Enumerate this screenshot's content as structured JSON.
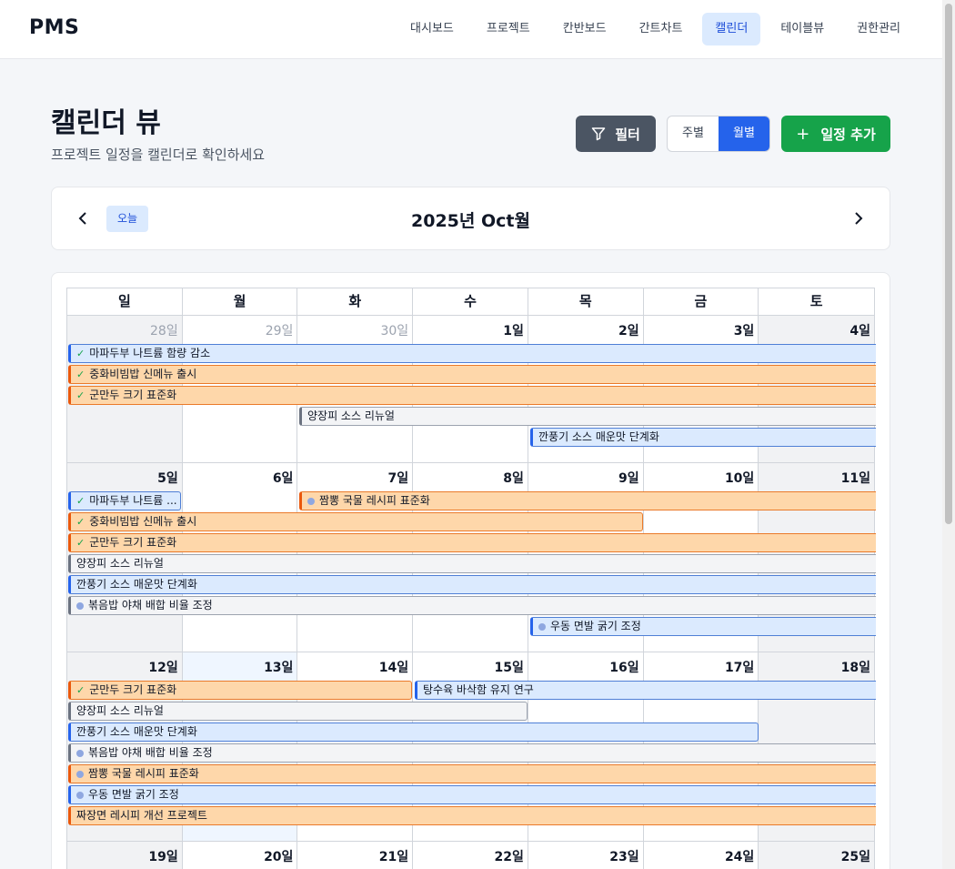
{
  "app": {
    "logo": "PMS"
  },
  "nav": [
    {
      "label": "대시보드",
      "active": false
    },
    {
      "label": "프로젝트",
      "active": false
    },
    {
      "label": "칸반보드",
      "active": false
    },
    {
      "label": "간트차트",
      "active": false
    },
    {
      "label": "캘린더",
      "active": true
    },
    {
      "label": "테이블뷰",
      "active": false
    },
    {
      "label": "권한관리",
      "active": false
    }
  ],
  "page": {
    "title": "캘린더 뷰",
    "subtitle": "프로젝트 일정을 캘린더로 확인하세요"
  },
  "toolbar": {
    "filter_label": "필터",
    "weekly_label": "주별",
    "monthly_label": "월별",
    "add_label": "일정 추가"
  },
  "calendar": {
    "today_label": "오늘",
    "month_title": "2025년 Oct월",
    "weekdays": [
      "일",
      "월",
      "화",
      "수",
      "목",
      "금",
      "토"
    ],
    "weeks": [
      {
        "days": [
          "28일",
          "29일",
          "30일",
          "1일",
          "2일",
          "3일",
          "4일"
        ],
        "events": [
          {
            "title": "마파두부 나트륨 함량 감소",
            "color": "blue",
            "icon": "check",
            "start": 0,
            "span": 7,
            "lane": 0,
            "cont": true
          },
          {
            "title": "중화비빔밥 신메뉴 출시",
            "color": "orange",
            "icon": "check",
            "start": 0,
            "span": 7,
            "lane": 1,
            "cont": true
          },
          {
            "title": "군만두 크기 표준화",
            "color": "orange",
            "icon": "check",
            "start": 0,
            "span": 7,
            "lane": 2,
            "cont": true
          },
          {
            "title": "양장피 소스 리뉴얼",
            "color": "gray",
            "icon": "",
            "start": 2,
            "span": 5,
            "lane": 3,
            "cont": true
          },
          {
            "title": "깐풍기 소스 매운맛 단계화",
            "color": "blue",
            "icon": "",
            "start": 4,
            "span": 3,
            "lane": 4,
            "cont": true
          }
        ]
      },
      {
        "days": [
          "5일",
          "6일",
          "7일",
          "8일",
          "9일",
          "10일",
          "11일"
        ],
        "events": [
          {
            "title": "마파두부 나트륨 ...",
            "color": "blue",
            "icon": "check",
            "start": 0,
            "span": 1,
            "lane": 0,
            "cont": false
          },
          {
            "title": "짬뽕 국물 레시피 표준화",
            "color": "orange",
            "icon": "dot",
            "start": 2,
            "span": 5,
            "lane": 0,
            "cont": true
          },
          {
            "title": "중화비빔밥 신메뉴 출시",
            "color": "orange",
            "icon": "check",
            "start": 0,
            "span": 5,
            "lane": 1,
            "cont": false
          },
          {
            "title": "군만두 크기 표준화",
            "color": "orange",
            "icon": "check",
            "start": 0,
            "span": 7,
            "lane": 2,
            "cont": true
          },
          {
            "title": "양장피 소스 리뉴얼",
            "color": "gray",
            "icon": "",
            "start": 0,
            "span": 7,
            "lane": 3,
            "cont": true
          },
          {
            "title": "깐풍기 소스 매운맛 단계화",
            "color": "blue",
            "icon": "",
            "start": 0,
            "span": 7,
            "lane": 4,
            "cont": true
          },
          {
            "title": "볶음밥 야채 배합 비율 조정",
            "color": "gray",
            "icon": "dot",
            "start": 0,
            "span": 7,
            "lane": 5,
            "cont": true
          },
          {
            "title": "우동 면발 굵기 조정",
            "color": "blue",
            "icon": "dot",
            "start": 4,
            "span": 3,
            "lane": 6,
            "cont": true
          }
        ]
      },
      {
        "days": [
          "12일",
          "13일",
          "14일",
          "15일",
          "16일",
          "17일",
          "18일"
        ],
        "events": [
          {
            "title": "군만두 크기 표준화",
            "color": "orange",
            "icon": "check",
            "start": 0,
            "span": 3,
            "lane": 0,
            "cont": false
          },
          {
            "title": "탕수육 바삭함 유지 연구",
            "color": "blue",
            "icon": "",
            "start": 3,
            "span": 4,
            "lane": 0,
            "cont": true
          },
          {
            "title": "양장피 소스 리뉴얼",
            "color": "gray",
            "icon": "",
            "start": 0,
            "span": 4,
            "lane": 1,
            "cont": false
          },
          {
            "title": "깐풍기 소스 매운맛 단계화",
            "color": "blue",
            "icon": "",
            "start": 0,
            "span": 6,
            "lane": 2,
            "cont": false
          },
          {
            "title": "볶음밥 야채 배합 비율 조정",
            "color": "gray",
            "icon": "dot",
            "start": 0,
            "span": 7,
            "lane": 3,
            "cont": true
          },
          {
            "title": "짬뽕 국물 레시피 표준화",
            "color": "orange",
            "icon": "dot",
            "start": 0,
            "span": 7,
            "lane": 4,
            "cont": true
          },
          {
            "title": "우동 면발 굵기 조정",
            "color": "blue",
            "icon": "dot",
            "start": 0,
            "span": 7,
            "lane": 5,
            "cont": true
          },
          {
            "title": "짜장면 레시피 개선 프로젝트",
            "color": "orange",
            "icon": "",
            "start": 0,
            "span": 7,
            "lane": 6,
            "cont": true
          }
        ]
      },
      {
        "days": [
          "19일",
          "20일",
          "21일",
          "22일",
          "23일",
          "24일",
          "25일"
        ],
        "events": []
      }
    ]
  },
  "colors": {
    "accent": "#2563eb",
    "success": "#16a34a",
    "filter": "#4b5563",
    "orange": "#ea580c"
  }
}
